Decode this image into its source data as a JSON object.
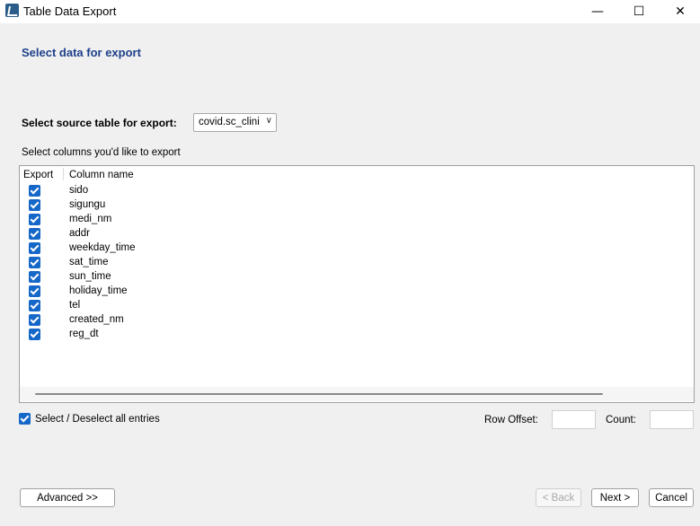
{
  "window": {
    "title": "Table Data Export",
    "minimize_glyph": "—",
    "maximize_glyph": "☐",
    "close_glyph": "✕"
  },
  "page": {
    "heading": "Select data for export"
  },
  "source": {
    "label": "Select source table for export:",
    "selected": "covid.sc_clini",
    "chevron": "∨"
  },
  "columns": {
    "label": "Select columns you'd like to export",
    "header_export": "Export",
    "header_name": "Column name",
    "rows": [
      {
        "name": "sido",
        "checked": true
      },
      {
        "name": "sigungu",
        "checked": true
      },
      {
        "name": "medi_nm",
        "checked": true
      },
      {
        "name": "addr",
        "checked": true
      },
      {
        "name": "weekday_time",
        "checked": true
      },
      {
        "name": "sat_time",
        "checked": true
      },
      {
        "name": "sun_time",
        "checked": true
      },
      {
        "name": "holiday_time",
        "checked": true
      },
      {
        "name": "tel",
        "checked": true
      },
      {
        "name": "created_nm",
        "checked": true
      },
      {
        "name": "reg_dt",
        "checked": true
      }
    ]
  },
  "options": {
    "select_all_label": "Select / Deselect all entries",
    "select_all_checked": true,
    "row_offset_label": "Row Offset:",
    "row_offset_value": "",
    "count_label": "Count:",
    "count_value": ""
  },
  "buttons": {
    "advanced": "Advanced >>",
    "back": "< Back",
    "next": "Next >",
    "cancel": "Cancel"
  },
  "colors": {
    "accent": "#1567c8",
    "heading": "#1d3f8a"
  }
}
